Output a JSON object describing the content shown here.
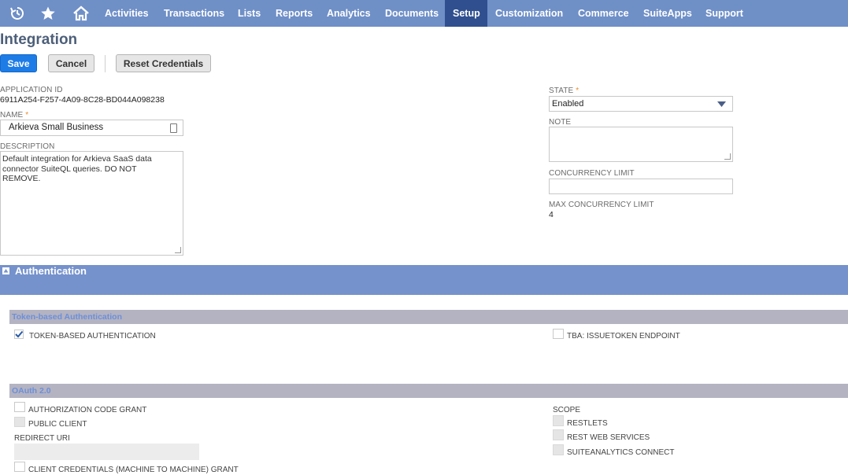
{
  "nav": {
    "items": [
      "Activities",
      "Transactions",
      "Lists",
      "Reports",
      "Analytics",
      "Documents",
      "Setup",
      "Customization",
      "Commerce",
      "SuiteApps",
      "Support"
    ],
    "active": "Setup",
    "icons": [
      "recent-history-icon",
      "star-icon",
      "home-icon"
    ]
  },
  "page": {
    "title": "Integration"
  },
  "buttons": {
    "save": "Save",
    "cancel": "Cancel",
    "reset": "Reset Credentials"
  },
  "form": {
    "application_id": {
      "label": "APPLICATION ID",
      "value": "6911A254-F257-4A09-8C28-BD044A098238"
    },
    "name": {
      "label": "NAME",
      "required": "*",
      "value": "Arkieva Small Business"
    },
    "description": {
      "label": "DESCRIPTION",
      "value": "Default integration for Arkieva SaaS data connector SuiteQL queries. DO NOT REMOVE."
    },
    "state": {
      "label": "STATE",
      "required": "*",
      "value": "Enabled"
    },
    "note": {
      "label": "NOTE",
      "value": ""
    },
    "concurrency_limit": {
      "label": "CONCURRENCY LIMIT",
      "value": ""
    },
    "max_concurrency_limit": {
      "label": "MAX CONCURRENCY LIMIT",
      "value": "4"
    }
  },
  "authentication": {
    "title": "Authentication",
    "tba": {
      "title": "Token-based Authentication",
      "token_based": {
        "label": "TOKEN-BASED AUTHENTICATION",
        "checked": true
      },
      "issuetoken": {
        "label": "TBA: ISSUETOKEN ENDPOINT",
        "checked": false
      }
    },
    "oauth": {
      "title": "OAuth 2.0",
      "auth_code_grant": {
        "label": "AUTHORIZATION CODE GRANT",
        "checked": false
      },
      "public_client": {
        "label": "PUBLIC CLIENT",
        "checked": false
      },
      "redirect_uri": {
        "label": "REDIRECT URI",
        "value": ""
      },
      "client_credentials": {
        "label": "CLIENT CREDENTIALS (MACHINE TO MACHINE) GRANT",
        "checked": false
      },
      "scope": {
        "label": "SCOPE",
        "restlets": "RESTLETS",
        "rest_web_services": "REST WEB SERVICES",
        "suiteanalytics_connect": "SUITEANALYTICS CONNECT"
      }
    }
  },
  "colors": {
    "nav": "#6f8fc7",
    "nav_active": "#2f4f8f",
    "band": "#7592cc",
    "subbar": "#b4b3c2",
    "save": "#1e7ce6"
  }
}
